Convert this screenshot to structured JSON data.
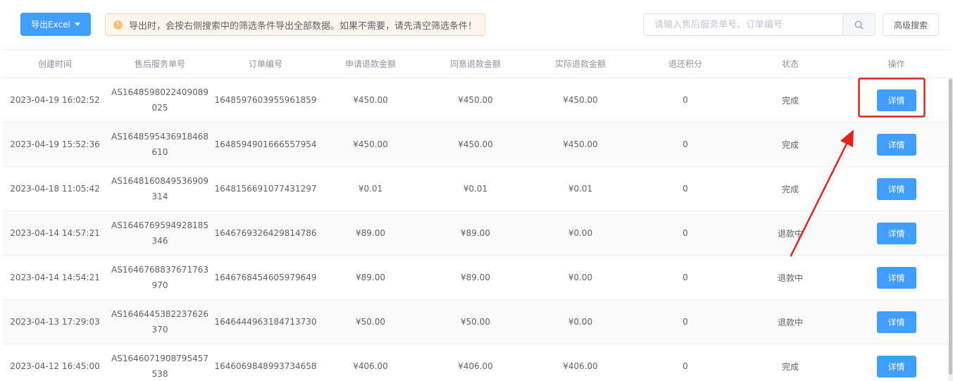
{
  "toolbar": {
    "export_label": "导出Excel",
    "notice_text": "导出时，会按右侧搜索中的筛选条件导出全部数据。如果不需要，请先清空筛选条件！",
    "search_placeholder": "请输入售后服务单号、订单编号",
    "search_value": "",
    "advanced_label": "高级搜索"
  },
  "table": {
    "headers": [
      "创建时间",
      "售后服务单号",
      "订单编号",
      "申请退款金额",
      "同意退款金额",
      "实际退款金额",
      "退还积分",
      "状态",
      "操作"
    ],
    "rows": [
      {
        "created": "2023-04-19 16:02:52",
        "service_no": "AS1648598022409089025",
        "order_no": "1648597603955961859",
        "apply": "¥450.00",
        "agree": "¥450.00",
        "actual": "¥450.00",
        "points": "0",
        "status": "完成",
        "action": "详情"
      },
      {
        "created": "2023-04-19 15:52:36",
        "service_no": "AS1648595436918468610",
        "order_no": "1648594901666557954",
        "apply": "¥450.00",
        "agree": "¥450.00",
        "actual": "¥450.00",
        "points": "0",
        "status": "完成",
        "action": "详情"
      },
      {
        "created": "2023-04-18 11:05:42",
        "service_no": "AS1648160849536909314",
        "order_no": "1648156691077431297",
        "apply": "¥0.01",
        "agree": "¥0.01",
        "actual": "¥0.01",
        "points": "0",
        "status": "完成",
        "action": "详情"
      },
      {
        "created": "2023-04-14 14:57:21",
        "service_no": "AS1646769594928185346",
        "order_no": "1646769326429814786",
        "apply": "¥89.00",
        "agree": "¥89.00",
        "actual": "¥0.00",
        "points": "0",
        "status": "退款中",
        "action": "详情"
      },
      {
        "created": "2023-04-14 14:54:21",
        "service_no": "AS1646768837671763970",
        "order_no": "1646768454605979649",
        "apply": "¥89.00",
        "agree": "¥89.00",
        "actual": "¥0.00",
        "points": "0",
        "status": "退款中",
        "action": "详情"
      },
      {
        "created": "2023-04-13 17:29:03",
        "service_no": "AS1646445382237626370",
        "order_no": "1646444963184713730",
        "apply": "¥50.00",
        "agree": "¥50.00",
        "actual": "¥0.00",
        "points": "0",
        "status": "退款中",
        "action": "详情"
      },
      {
        "created": "2023-04-12 16:45:00",
        "service_no": "AS1646071908795457538",
        "order_no": "1646069848993734658",
        "apply": "¥406.00",
        "agree": "¥406.00",
        "actual": "¥406.00",
        "points": "0",
        "status": "完成",
        "action": "详情"
      }
    ]
  },
  "colors": {
    "primary": "#409eff",
    "highlight": "#e8201a",
    "warning_bg": "#fdf6ec",
    "warning_border": "#f5dab1"
  },
  "icons": {
    "export_caret": "caret-down-icon",
    "notice": "warning-icon",
    "search": "search-icon"
  }
}
